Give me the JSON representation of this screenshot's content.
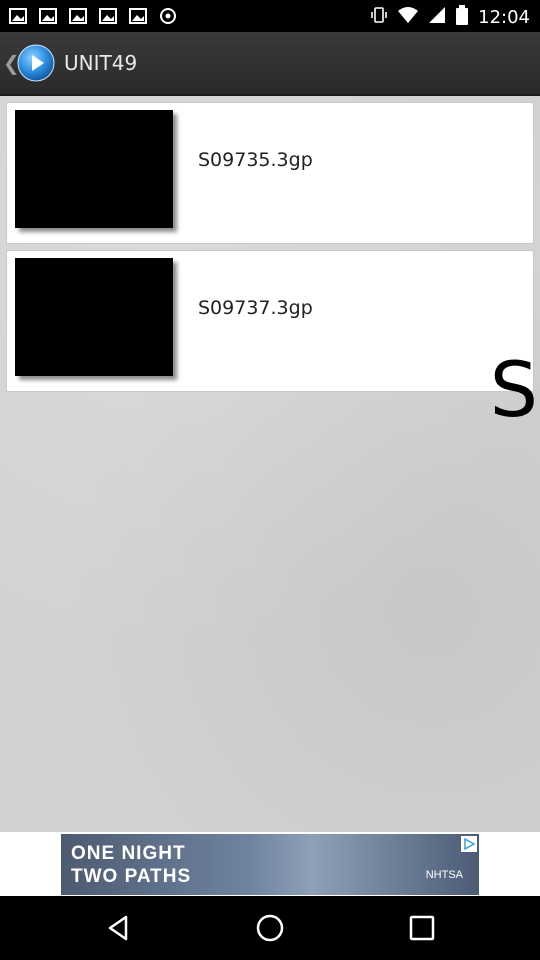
{
  "status_bar": {
    "time": "12:04",
    "left_icons": [
      "image-icon",
      "image-icon",
      "image-icon",
      "image-icon",
      "image-icon",
      "target-icon"
    ],
    "right_icons": [
      "vibrate-icon",
      "wifi-icon",
      "signal-icon",
      "battery-icon"
    ]
  },
  "app_bar": {
    "title": "UNIT49",
    "logo_icon": "play-circle-icon"
  },
  "files": [
    {
      "name": "S09735.3gp"
    },
    {
      "name": "S09737.3gp"
    }
  ],
  "side_letter": "S",
  "ad": {
    "line1": "ONE NIGHT",
    "line2": "TWO PATHS",
    "sponsor": "NHTSA"
  },
  "nav": {
    "back": "back-icon",
    "home": "home-icon",
    "recents": "recents-icon"
  },
  "colors": {
    "app_bar": "#333333",
    "background": "#d2d2d2",
    "logo_blue": "#2d8fe0"
  }
}
